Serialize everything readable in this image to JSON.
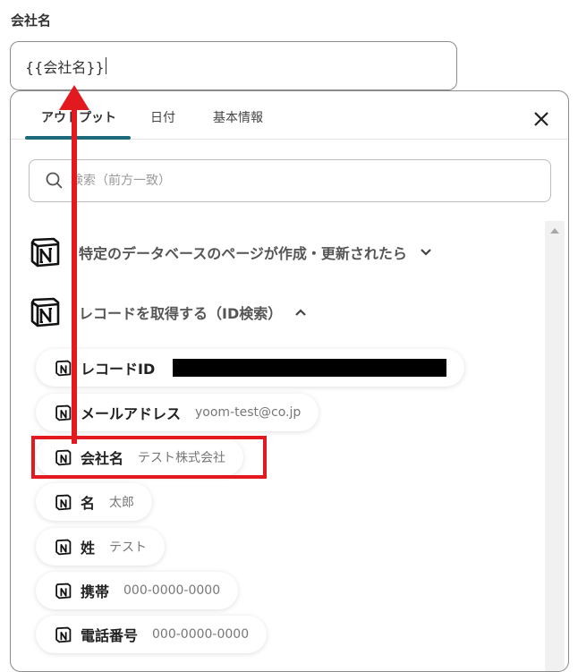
{
  "field": {
    "label": "会社名",
    "value": "{{会社名}}"
  },
  "tabs": [
    {
      "label": "アウトプット",
      "active": true
    },
    {
      "label": "日付",
      "active": false
    },
    {
      "label": "基本情報",
      "active": false
    }
  ],
  "search": {
    "placeholder": "検索（前方一致）"
  },
  "sections": [
    {
      "title": "特定のデータベースのページが作成・更新されたら",
      "expanded": false
    },
    {
      "title": "レコードを取得する（ID検索）",
      "expanded": true
    }
  ],
  "items": [
    {
      "label": "レコードID",
      "value": "",
      "redacted": true
    },
    {
      "label": "メールアドレス",
      "value": "yoom-test@co.jp"
    },
    {
      "label": "会社名",
      "value": "テスト株式会社",
      "highlighted": true
    },
    {
      "label": "名",
      "value": "太郎"
    },
    {
      "label": "姓",
      "value": "テスト"
    },
    {
      "label": "携帯",
      "value": "000-0000-0000"
    },
    {
      "label": "電話番号",
      "value": "000-0000-0000"
    }
  ],
  "colors": {
    "accent": "#1e6a7a",
    "annotation": "#e2191f"
  },
  "icons": [
    "search-icon",
    "close-icon",
    "notion-icon",
    "chevron-down-icon",
    "chevron-up-icon"
  ]
}
